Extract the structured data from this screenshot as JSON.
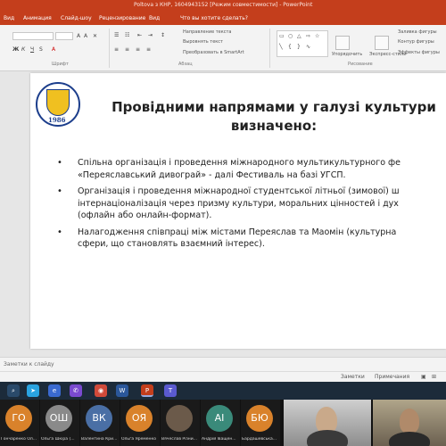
{
  "window": {
    "title": "Poltova з КНР, 1604943152 [Режим совместимости] - PowerPoint"
  },
  "ribbon_tabs": [
    "Вид",
    "Анимация",
    "Слайд-шоу",
    "Рецензирование",
    "Вид",
    "Что вы хотите сделать?"
  ],
  "ribbon": {
    "text_direction_label": "Направление текста",
    "align_text_label": "Выровнять текст",
    "smartart_label": "Преобразовать в SmartArt",
    "arrange_label": "Упорядочить",
    "express_styles_label": "Экспресс-стили",
    "shape_fill_label": "Заливка фигуры",
    "shape_outline_label": "Контур фигуры",
    "shape_effects_label": "Эффекты фигуры",
    "groups": {
      "font": "Шрифт",
      "paragraph": "Абзац",
      "drawing": "Рисование"
    }
  },
  "slide": {
    "logo_year": "1986",
    "title_lines": [
      "Провідними напрямами у галузі культури",
      "визначено:"
    ],
    "bullets": [
      {
        "lines": [
          "Спільна організація і проведення міжнародного мультикультурного фе",
          "«Переяславський дивограй» - далі Фестиваль на базі УГСП."
        ]
      },
      {
        "lines": [
          "Організація і проведення міжнародної студентської літньої (зимової) ш",
          "інтернаціоналізація через призму культури, моральних цінностей і дух",
          "(офлайн або онлайн-формат)."
        ]
      },
      {
        "lines": [
          "Налагодження співпраці між містами Переяслав та Маомін (культурна",
          "сфери, що становлять взаємний інтерес)."
        ]
      }
    ]
  },
  "notes": {
    "placeholder": "Заметки к слайду"
  },
  "status": {
    "notes_label": "Заметки",
    "comments_label": "Примечания"
  },
  "participants": [
    {
      "initials": "ГО",
      "name": "Гончаренко Ол...",
      "color": "#d9822b"
    },
    {
      "initials": "ОШ",
      "name": "Ольга Шкіра (...",
      "color": "#8a8a8a"
    },
    {
      "initials": "ВК",
      "name": "Валентина Кри...",
      "color": "#4a6fa5"
    },
    {
      "initials": "ОЯ",
      "name": "Ольга Яременко",
      "color": "#d9822b"
    },
    {
      "initials": "",
      "name": "Вячеслав Різни...",
      "color": "#6b5a4a"
    },
    {
      "initials": "АІ",
      "name": "Андрій Іващен...",
      "color": "#3a8a7a"
    },
    {
      "initials": "БЮ",
      "name": "Бардашевська...",
      "color": "#d9822b"
    }
  ]
}
